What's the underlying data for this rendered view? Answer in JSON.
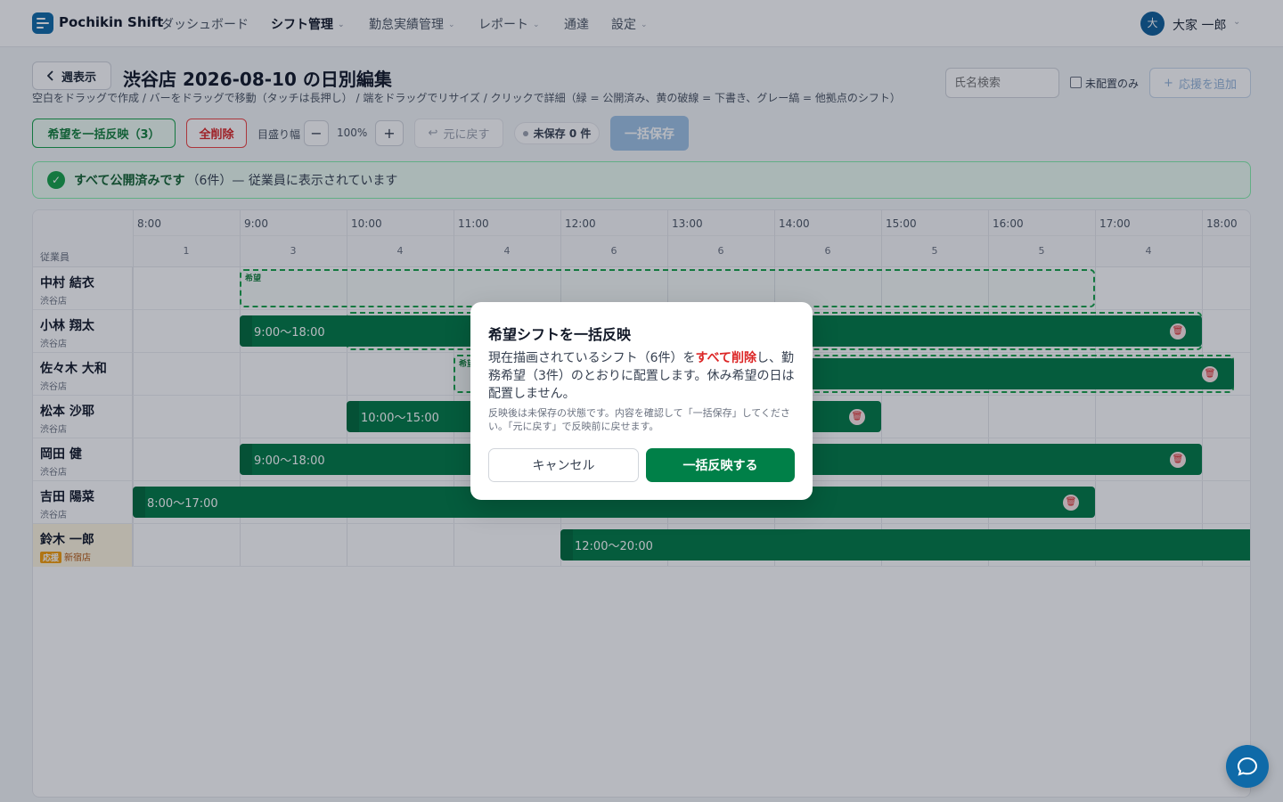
{
  "app": {
    "brand": "Pochikin Shift"
  },
  "nav": [
    {
      "label": "ダッシュボード",
      "has_menu": false,
      "active": false
    },
    {
      "label": "シフト管理",
      "has_menu": true,
      "active": true
    },
    {
      "label": "勤怠実績管理",
      "has_menu": true,
      "active": false
    },
    {
      "label": "レポート",
      "has_menu": true,
      "active": false
    },
    {
      "label": "通達",
      "has_menu": false,
      "active": false
    },
    {
      "label": "設定",
      "has_menu": true,
      "active": false
    }
  ],
  "user": {
    "avatar": "大",
    "name": "大家 一郎"
  },
  "page": {
    "back_label": "週表示",
    "title": "渋谷店 2026-08-10 の日別編集",
    "hint": "空白をドラッグで作成 / バーをドラッグで移動（タッチは長押し） / 端をドラッグでリサイズ / クリックで詳細（緑 = 公開済み、黄の破線 = 下書き、グレー縞 = 他拠点のシフト）",
    "search_placeholder": "氏名検索",
    "unassigned_label": "未配置のみ",
    "add_support_label": "応援を追加"
  },
  "toolbar": {
    "apply_wishes_label": "希望を一括反映（3）",
    "delete_all_label": "全削除",
    "tick_width_label": "目盛り幅",
    "minus": "−",
    "zoom": "100%",
    "plus": "+",
    "undo_label": "元に戻す",
    "unsaved_label": "未保存 0 件",
    "save_label": "一括保存"
  },
  "banner": {
    "strong": "すべて公開済みです",
    "rest": "（6件）— 従業員に表示されています"
  },
  "grid": {
    "employee_header": "従業員",
    "hours": [
      "8:00",
      "9:00",
      "10:00",
      "11:00",
      "12:00",
      "13:00",
      "14:00",
      "15:00",
      "16:00",
      "17:00",
      "18:00"
    ],
    "counts": [
      "1",
      "3",
      "4",
      "4",
      "6",
      "6",
      "6",
      "5",
      "5",
      "4"
    ],
    "wish_label": "希望",
    "rows": [
      {
        "name": "中村 結衣",
        "store": "渋谷店",
        "support": false,
        "shift": null,
        "wish": {
          "start": 9,
          "end": 17
        }
      },
      {
        "name": "小林 翔太",
        "store": "渋谷店",
        "support": false,
        "shift": {
          "label": "9:00〜18:00",
          "start": 9,
          "end": 18
        },
        "wish": {
          "start": 10,
          "end": 18
        }
      },
      {
        "name": "佐々木 大和",
        "store": "渋谷店",
        "support": false,
        "shift": {
          "label": "",
          "start": 13.2,
          "end": 18.3
        },
        "wish": {
          "start": 11,
          "end": 18.3
        }
      },
      {
        "name": "松本 沙耶",
        "store": "渋谷店",
        "support": false,
        "shift": {
          "label": "10:00〜15:00",
          "start": 10,
          "end": 15
        },
        "wish": null
      },
      {
        "name": "岡田 健",
        "store": "渋谷店",
        "support": false,
        "shift": {
          "label": "9:00〜18:00",
          "start": 9,
          "end": 18
        },
        "wish": null
      },
      {
        "name": "吉田 陽菜",
        "store": "渋谷店",
        "support": false,
        "shift": {
          "label": "8:00〜17:00",
          "start": 8,
          "end": 17
        },
        "wish": null
      },
      {
        "name": "鈴木 一郎",
        "store": "新宿店",
        "support": true,
        "support_tag": "応援",
        "shift": {
          "label": "12:00〜20:00",
          "start": 12,
          "end": 20,
          "no_delete": true
        },
        "wish": null
      }
    ]
  },
  "modal": {
    "title": "希望シフトを一括反映",
    "body_pre": "現在描画されているシフト（6件）を",
    "body_red": "すべて削除",
    "body_post": "し、勤務希望（3件）のとおりに配置します。休み希望の日は配置しません。",
    "note": "反映後は未保存の状態です。内容を確認して「一括保存」してください。「元に戻す」で反映前に戻せます。",
    "cancel_label": "キャンセル",
    "confirm_label": "一括反映する"
  },
  "icons": {
    "back": "chevron-left-icon",
    "trash": "trash-icon",
    "check": "check-circle-icon",
    "chat": "chat-icon",
    "undo": "undo-icon",
    "plus": "plus-icon"
  },
  "colors": {
    "published": "#007a45",
    "wish_border": "#16a34a",
    "primary": "#0f6aa8",
    "danger": "#dc2626"
  }
}
